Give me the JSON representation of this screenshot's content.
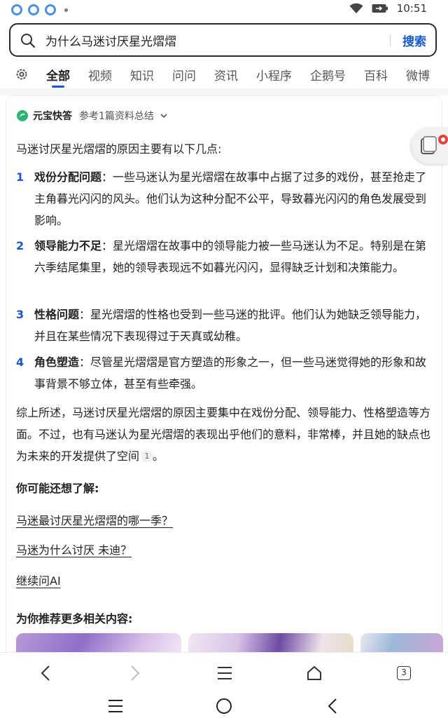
{
  "status_bar": {
    "time": "10:51",
    "icons": [
      "notification-icon",
      "notification-icon",
      "notification-icon",
      "wifi-icon",
      "battery-icon"
    ]
  },
  "search": {
    "query": "为什么马迷讨厌星光熠熠",
    "button_label": "搜索"
  },
  "tabs": [
    "全部",
    "视频",
    "知识",
    "问问",
    "资讯",
    "小程序",
    "企鹅号",
    "百科",
    "微博"
  ],
  "active_tab": "全部",
  "answer": {
    "brand": "元宝快答",
    "reference": "参考1篇资料总结",
    "intro": "马迷讨厌星光熠熠的原因主要有以下几点:",
    "items": [
      {
        "num": "1",
        "title": "戏份分配问题",
        "text": "：一些马迷认为星光熠熠在故事中占据了过多的戏份，甚至抢走了主角暮光闪闪的风头。他们认为这种分配不公平，导致暮光闪闪的角色发展受到影响。"
      },
      {
        "num": "2",
        "title": "领导能力不足",
        "text": "：星光熠熠在故事中的领导能力被一些马迷认为不足。特别是在第六季结尾集里，她的领导表现远不如暮光闪闪，显得缺乏计划和决策能力。"
      },
      {
        "num": "3",
        "title": "性格问题",
        "text": "：星光熠熠的性格也受到一些马迷的批评。他们认为她缺乏领导能力，并且在某些情况下表现得过于天真或幼稚。"
      },
      {
        "num": "4",
        "title": "角色塑造",
        "text": "：尽管星光熠熠是官方塑造的形象之一，但一些马迷觉得她的形象和故事背景不够立体，甚至有些牵强。"
      }
    ],
    "summary": "综上所述，马迷讨厌星光熠熠的原因主要集中在戏份分配、领导能力、性格塑造等方面。不过，也有马迷认为星光熠熠的表现出乎他们的意料，非常棒，并且她的缺点也为未来的开发提供了空间",
    "citation": "1",
    "summary_end": "。",
    "maybe_title": "你可能还想了解:",
    "questions": [
      "马迷最讨厌星光熠熠的哪一季？",
      "马迷为什么讨厌 未迪？"
    ],
    "continue_label": "继续问AI",
    "recommend_title": "为你推荐更多相关内容:"
  },
  "browser_bar": {
    "tab_count": "3"
  },
  "colors": {
    "accent": "#1558d6",
    "brand_green": "#2bb673"
  }
}
